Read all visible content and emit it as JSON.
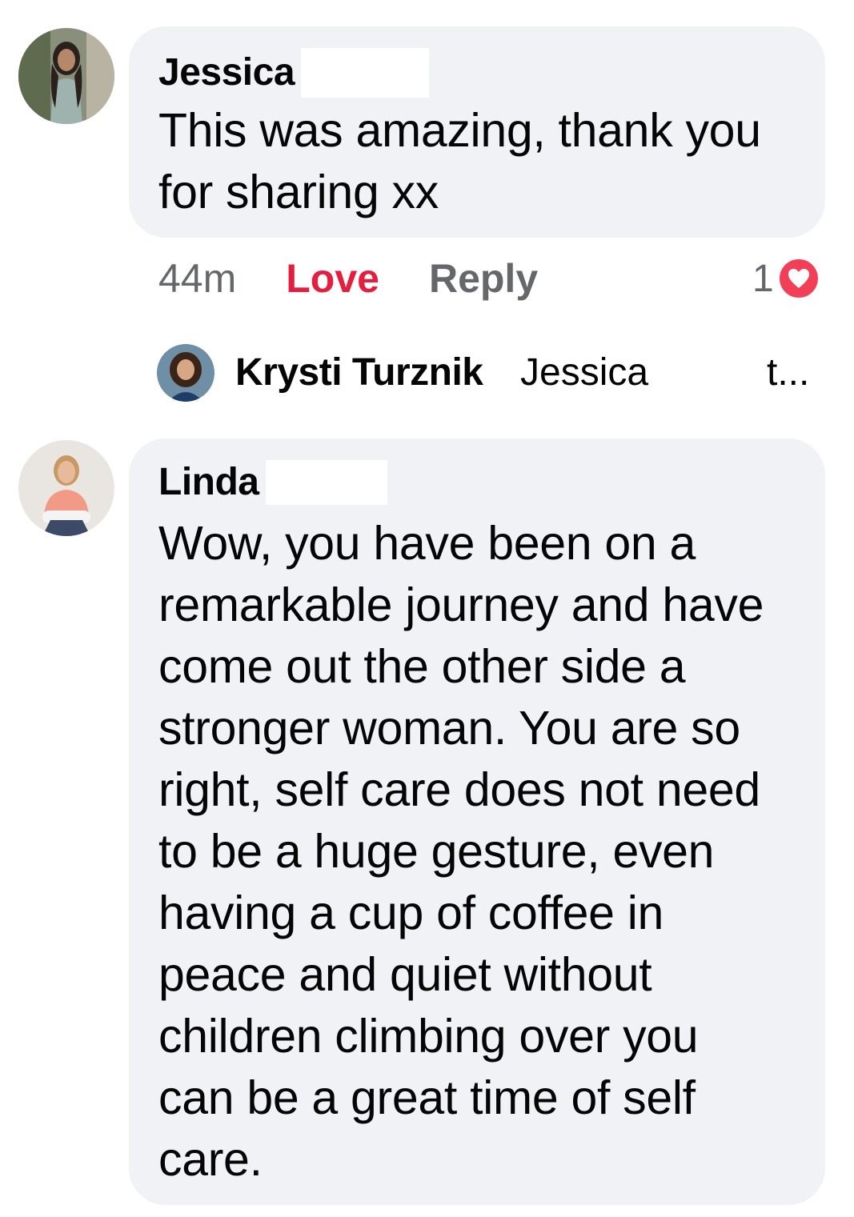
{
  "comments": [
    {
      "author": "Jessica",
      "avatar": "woman-avatar",
      "text_lines": [
        "This was amazing, thank you",
        "for sharing xx"
      ],
      "time": "44m",
      "love_label": "Love",
      "reply_label": "Reply",
      "reaction_count": "1",
      "reaction_icon": "heart-icon"
    },
    {
      "author": "Linda",
      "avatar": "woman-avatar",
      "text_lines": [
        "Wow, you have been on a",
        "remarkable journey and have",
        "come out the other side a",
        "stronger woman. You are so",
        "right, self care does not need",
        "to be a huge gesture, even",
        "having a cup of coffee in",
        "peace and quiet without",
        "children climbing over you",
        "can be a great time of self",
        "care."
      ]
    }
  ],
  "reply_preview": {
    "author": "Krysti Turznik",
    "mention": "Jessica",
    "truncated_text": "t..."
  },
  "colors": {
    "bubble_bg": "#f0f2f5",
    "love": "#e41e3f",
    "muted": "#65676b",
    "heart": "#f33e58"
  }
}
